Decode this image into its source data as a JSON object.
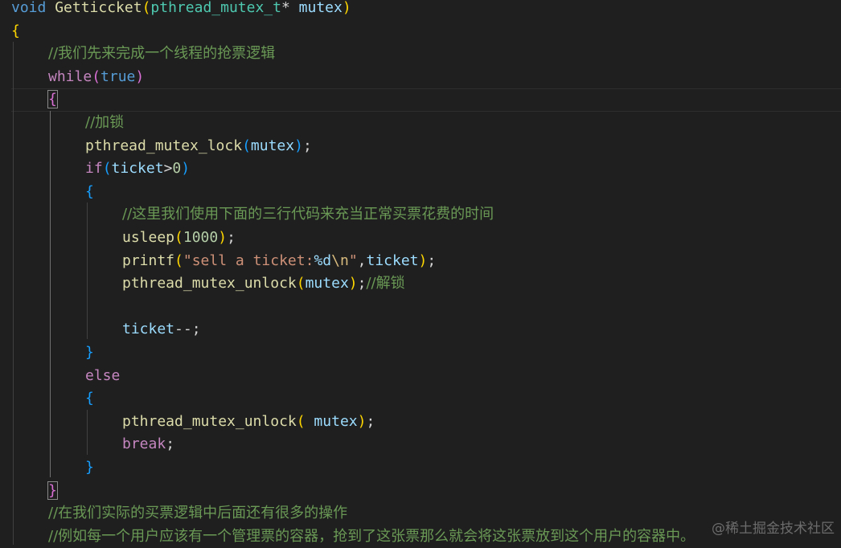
{
  "editor": {
    "lines": [
      {
        "indent": 0,
        "tokens": [
          {
            "t": "void",
            "c": "kw"
          },
          {
            "t": " ",
            "c": "plain"
          },
          {
            "t": "Getticcket",
            "c": "fn"
          },
          {
            "t": "(",
            "c": "b1"
          },
          {
            "t": "pthread_mutex_t",
            "c": "ty"
          },
          {
            "t": "* ",
            "c": "plain"
          },
          {
            "t": "mutex",
            "c": "var"
          },
          {
            "t": ")",
            "c": "b1"
          }
        ]
      },
      {
        "indent": 0,
        "tokens": [
          {
            "t": "{",
            "c": "b1"
          }
        ]
      },
      {
        "indent": 1,
        "tokens": [
          {
            "t": "//我们先来完成一个线程的抢票逻辑",
            "c": "cm"
          }
        ]
      },
      {
        "indent": 1,
        "tokens": [
          {
            "t": "while",
            "c": "ctl"
          },
          {
            "t": "(",
            "c": "b2"
          },
          {
            "t": "true",
            "c": "kw"
          },
          {
            "t": ")",
            "c": "b2"
          }
        ]
      },
      {
        "indent": 1,
        "tokens": [
          {
            "t": "{",
            "c": "b2",
            "hl": true
          }
        ]
      },
      {
        "indent": 2,
        "tokens": [
          {
            "t": "//加锁",
            "c": "cm"
          }
        ]
      },
      {
        "indent": 2,
        "tokens": [
          {
            "t": "pthread_mutex_lock",
            "c": "fn"
          },
          {
            "t": "(",
            "c": "b3"
          },
          {
            "t": "mutex",
            "c": "var"
          },
          {
            "t": ")",
            "c": "b3"
          },
          {
            "t": ";",
            "c": "plain"
          }
        ]
      },
      {
        "indent": 2,
        "tokens": [
          {
            "t": "if",
            "c": "ctl"
          },
          {
            "t": "(",
            "c": "b3"
          },
          {
            "t": "ticket",
            "c": "var"
          },
          {
            "t": ">",
            "c": "plain"
          },
          {
            "t": "0",
            "c": "num"
          },
          {
            "t": ")",
            "c": "b3"
          }
        ]
      },
      {
        "indent": 2,
        "tokens": [
          {
            "t": "{",
            "c": "b3"
          }
        ]
      },
      {
        "indent": 3,
        "tokens": [
          {
            "t": "//这里我们使用下面的三行代码来充当正常买票花费的时间",
            "c": "cm"
          }
        ]
      },
      {
        "indent": 3,
        "tokens": [
          {
            "t": "usleep",
            "c": "fn"
          },
          {
            "t": "(",
            "c": "b1"
          },
          {
            "t": "1000",
            "c": "num"
          },
          {
            "t": ")",
            "c": "b1"
          },
          {
            "t": ";",
            "c": "plain"
          }
        ]
      },
      {
        "indent": 3,
        "tokens": [
          {
            "t": "printf",
            "c": "fn"
          },
          {
            "t": "(",
            "c": "b1"
          },
          {
            "t": "\"sell a ticket:",
            "c": "str"
          },
          {
            "t": "%d",
            "c": "var"
          },
          {
            "t": "\\n",
            "c": "esc"
          },
          {
            "t": "\"",
            "c": "str"
          },
          {
            "t": ",",
            "c": "plain"
          },
          {
            "t": "ticket",
            "c": "var"
          },
          {
            "t": ")",
            "c": "b1"
          },
          {
            "t": ";",
            "c": "plain"
          }
        ]
      },
      {
        "indent": 3,
        "tokens": [
          {
            "t": "pthread_mutex_unlock",
            "c": "fn"
          },
          {
            "t": "(",
            "c": "b1"
          },
          {
            "t": "mutex",
            "c": "var"
          },
          {
            "t": ")",
            "c": "b1"
          },
          {
            "t": ";",
            "c": "plain"
          },
          {
            "t": "//解锁",
            "c": "cm"
          }
        ]
      },
      {
        "indent": 3,
        "tokens": []
      },
      {
        "indent": 3,
        "tokens": [
          {
            "t": "ticket",
            "c": "var"
          },
          {
            "t": "--;",
            "c": "plain"
          }
        ]
      },
      {
        "indent": 2,
        "tokens": [
          {
            "t": "}",
            "c": "b3"
          }
        ]
      },
      {
        "indent": 2,
        "tokens": [
          {
            "t": "else",
            "c": "ctl"
          }
        ]
      },
      {
        "indent": 2,
        "tokens": [
          {
            "t": "{",
            "c": "b3"
          }
        ]
      },
      {
        "indent": 3,
        "tokens": [
          {
            "t": "pthread_mutex_unlock",
            "c": "fn"
          },
          {
            "t": "(",
            "c": "b1"
          },
          {
            "t": " mutex",
            "c": "var"
          },
          {
            "t": ")",
            "c": "b1"
          },
          {
            "t": ";",
            "c": "plain"
          }
        ]
      },
      {
        "indent": 3,
        "tokens": [
          {
            "t": "break",
            "c": "ctl"
          },
          {
            "t": ";",
            "c": "plain"
          }
        ]
      },
      {
        "indent": 2,
        "tokens": [
          {
            "t": "}",
            "c": "b3"
          }
        ]
      },
      {
        "indent": 1,
        "tokens": [
          {
            "t": "}",
            "c": "b2",
            "hl": true
          }
        ]
      },
      {
        "indent": 1,
        "tokens": [
          {
            "t": "//在我们实际的买票逻辑中后面还有很多的操作",
            "c": "cm"
          }
        ]
      },
      {
        "indent": 1,
        "tokens": [
          {
            "t": "//例如每一个用户应该有一个管理票的容器，抢到了这张票那么就会将这张票放到这个用户的容器中。",
            "c": "cm"
          }
        ]
      }
    ]
  },
  "watermark": "@稀土掘金技术社区",
  "theme": {
    "background": "#1f1f1f",
    "keyword": "#569cd6",
    "control": "#c586c0",
    "function": "#dcdcaa",
    "type": "#4ec9b0",
    "variable": "#9cdcfe",
    "string": "#ce9178",
    "number": "#b5cea8",
    "comment": "#6a9955",
    "bracket_1": "#ffd700",
    "bracket_2": "#da70d6",
    "bracket_3": "#179fff"
  }
}
